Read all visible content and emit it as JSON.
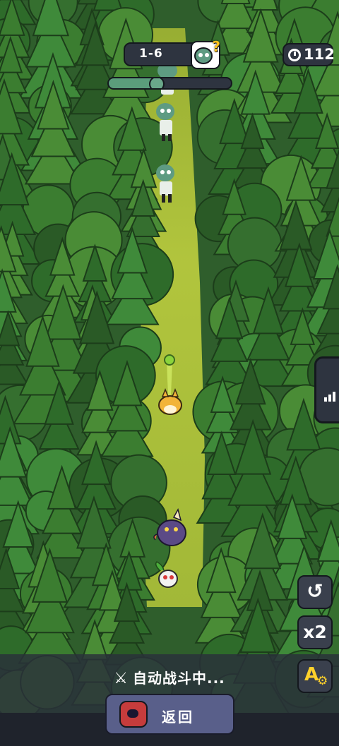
{
  "hud": {
    "level": "1-6",
    "boss_hint": "?",
    "timer": "112",
    "wave_progress": 0.42
  },
  "controls": {
    "restart_icon": "↺",
    "speed_label": "x2",
    "auto_skill_label": "A",
    "auto_skill_gear": "⚙"
  },
  "footer": {
    "auto_battle_text": "自动战斗中...",
    "back_label": "返回"
  },
  "colors": {
    "forest_dark": "#2f5e2c",
    "path_yellow": "#b9cc3c",
    "hud_panel": "#2e3440",
    "accent_yellow": "#ffc21e",
    "back_button": "#595f8a"
  }
}
